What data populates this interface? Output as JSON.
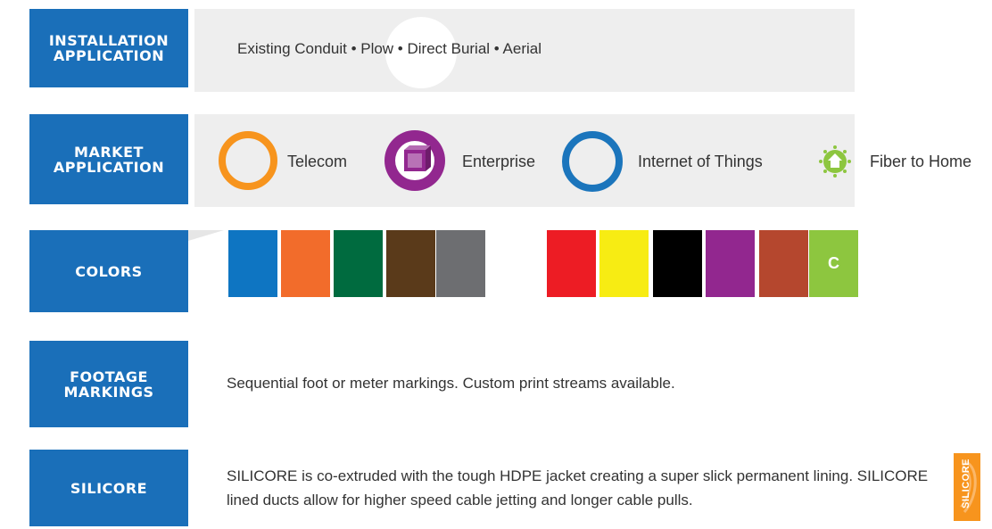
{
  "installation": {
    "label": "INSTALLATION\nAPPLICATION",
    "methods": "Existing Conduit • Plow • Direct Burial • Aerial"
  },
  "market": {
    "label": "MARKET\nAPPLICATION",
    "items": [
      {
        "label": "Telecom",
        "icon": "telecom-ring-icon",
        "color": "#f7941d"
      },
      {
        "label": "Enterprise",
        "icon": "enterprise-cube-icon",
        "color": "#92278f"
      },
      {
        "label": "Internet of Things",
        "icon": "iot-ring-icon",
        "color": "#1b75bc"
      },
      {
        "label": "Fiber to Home",
        "icon": "fiber-home-icon",
        "color": "#8dc63f"
      }
    ]
  },
  "colors": {
    "label": "COLORS",
    "swatches": [
      "#0e75c2",
      "#f26c2b",
      "#006b3f",
      "#5a3a1a",
      "#6d6e71",
      "#ed1c24",
      "#f7ec13",
      "#000000",
      "#92278f",
      "#b5472e",
      "#8dc63f"
    ],
    "custom_swatch_label": "C"
  },
  "footage": {
    "label": "FOOTAGE\nMARKINGS",
    "text": "Sequential foot or meter markings. Custom print streams available."
  },
  "silicore": {
    "label": "SILICORE",
    "text": "SILICORE is co-extruded with the tough HDPE jacket creating a super slick permanent lining. SILICORE lined ducts allow for higher speed cable jetting and longer cable pulls.",
    "logo_text": "SILICORE"
  }
}
